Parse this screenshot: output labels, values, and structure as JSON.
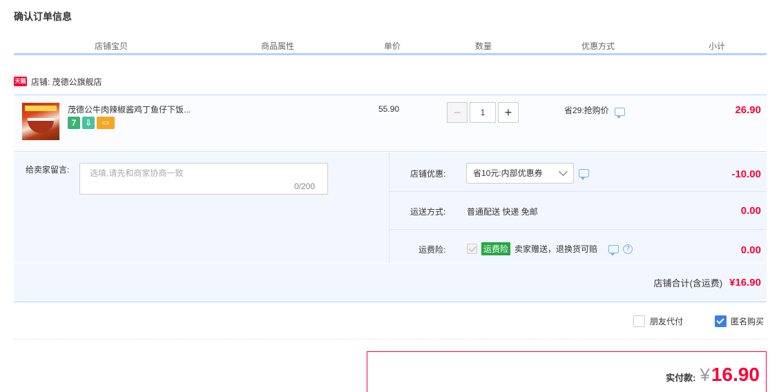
{
  "page": {
    "title": "确认订单信息"
  },
  "table_headers": [
    "店铺宝贝",
    "商品属性",
    "单价",
    "数量",
    "优惠方式",
    "小计"
  ],
  "shop": {
    "logo_text": "天猫",
    "label": "店铺: 茂德公旗舰店"
  },
  "item": {
    "title": "茂德公牛肉辣椒酱鸡丁鱼仔下饭...",
    "service_icons": [
      "7",
      "⇩",
      "▭"
    ],
    "service_icon_names": [
      "seven-day-return-icon",
      "shipping-guarantee-icon",
      "card-payment-icon"
    ],
    "unit_price": "55.90",
    "quantity": "1",
    "qty_minus": "−",
    "qty_plus": "+",
    "promotion": "省29:抢购价",
    "subtotal": "26.90"
  },
  "memo": {
    "label": "给卖家留言:",
    "placeholder": "选填,请先和商家协商一致",
    "counter": "0/200"
  },
  "shop_discount": {
    "label": "店铺优惠:",
    "selected": "省10元:内部优惠券",
    "amount": "-10.00"
  },
  "shipping": {
    "label": "运送方式:",
    "value": "普通配送 快递 免邮",
    "amount": "0.00"
  },
  "insurance": {
    "label": "运费险:",
    "tag": "运费险",
    "text": "卖家赠送，退换货可赔",
    "help": "?",
    "amount": "0.00"
  },
  "shop_total": {
    "label": "店铺合计(含运费)",
    "value": "¥16.90"
  },
  "options": {
    "friend_pay": "朋友代付",
    "anonymous": "匿名购买",
    "friend_pay_checked": false,
    "anonymous_checked": true
  },
  "payment": {
    "label": "实付款:",
    "currency": "¥",
    "amount": "16.90"
  },
  "colors": {
    "accent_red": "#ff0036",
    "header_line": "#b2d1ff",
    "panel_bg": "#f2f7ff",
    "checkbox_blue": "#3a7fe5"
  }
}
